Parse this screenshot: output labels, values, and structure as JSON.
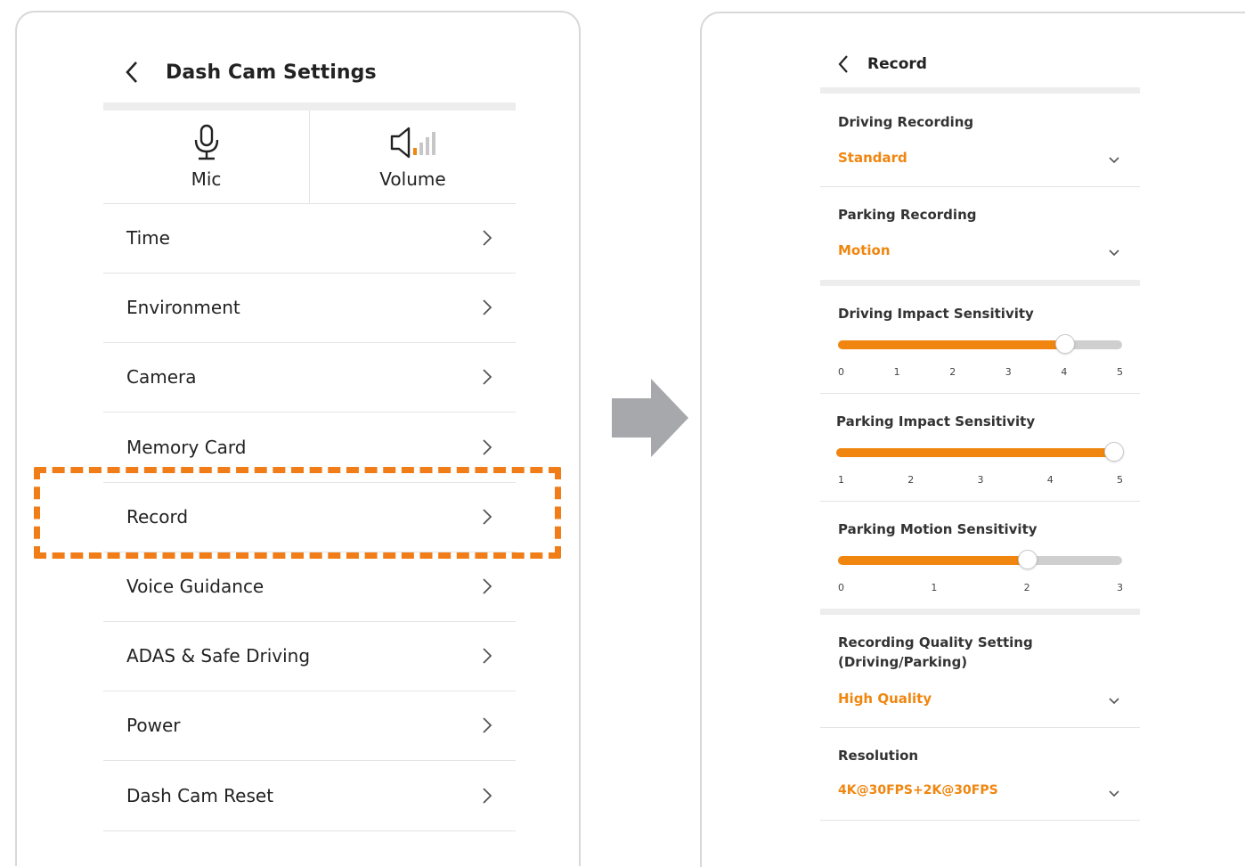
{
  "left_screen": {
    "title": "Dash Cam Settings",
    "quick": [
      {
        "label": "Mic",
        "icon": "mic-icon"
      },
      {
        "label": "Volume",
        "icon": "volume-icon"
      }
    ],
    "menu": [
      {
        "label": "Time"
      },
      {
        "label": "Environment"
      },
      {
        "label": "Camera"
      },
      {
        "label": "Memory Card"
      },
      {
        "label": "Record"
      },
      {
        "label": "Voice Guidance"
      },
      {
        "label": "ADAS & Safe Driving"
      },
      {
        "label": "Power"
      },
      {
        "label": "Dash Cam Reset"
      }
    ],
    "highlighted_item": "Record"
  },
  "right_screen": {
    "title": "Record",
    "driving_recording": {
      "label": "Driving Recording",
      "value": "Standard"
    },
    "parking_recording": {
      "label": "Parking Recording",
      "value": "Motion"
    },
    "driving_impact": {
      "label": "Driving Impact Sensitivity",
      "ticks": [
        "0",
        "1",
        "2",
        "3",
        "4",
        "5"
      ],
      "value": 4,
      "min": 0,
      "max": 5
    },
    "parking_impact": {
      "label": "Parking Impact Sensitivity",
      "ticks": [
        "1",
        "2",
        "3",
        "4",
        "5"
      ],
      "value": 5,
      "min": 1,
      "max": 5
    },
    "parking_motion": {
      "label": "Parking Motion Sensitivity",
      "ticks": [
        "0",
        "1",
        "2",
        "3"
      ],
      "value": 2,
      "min": 0,
      "max": 3
    },
    "quality": {
      "label_line1": "Recording Quality Setting",
      "label_line2": "(Driving/Parking)",
      "value": "High Quality"
    },
    "resolution": {
      "label": "Resolution",
      "value": "4K@30FPS+2K@30FPS"
    }
  },
  "colors": {
    "accent": "#f0860f",
    "highlight": "#f07d18",
    "arrow": "#a6a8ab"
  }
}
